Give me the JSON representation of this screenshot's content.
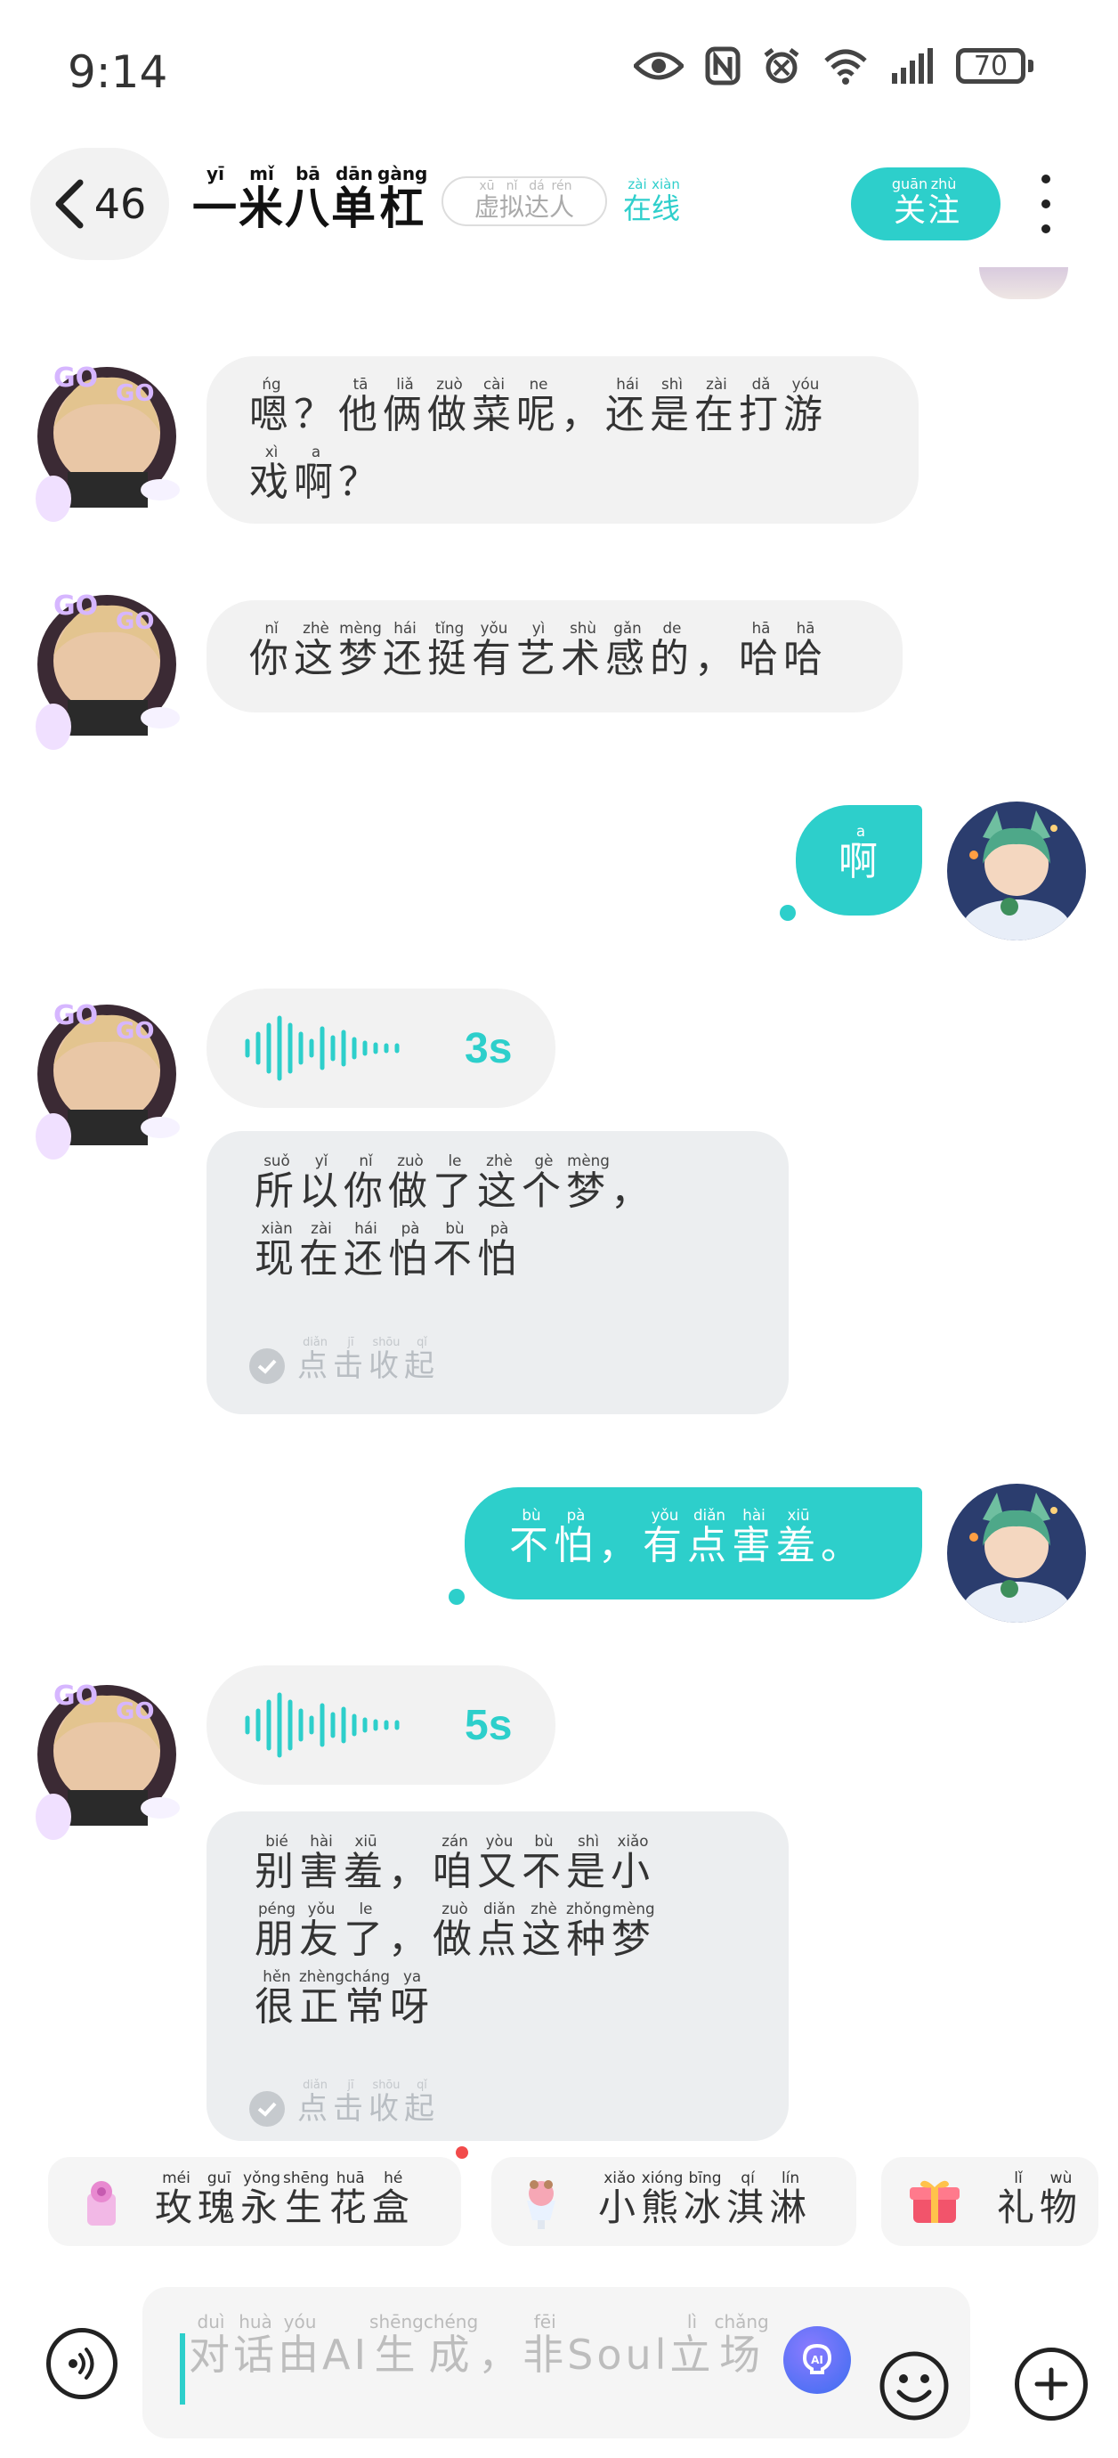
{
  "status_bar": {
    "time": "9:14",
    "battery": "70"
  },
  "header": {
    "back_count": "46",
    "name": [
      {
        "ch": "一",
        "py": "yī"
      },
      {
        "ch": "米",
        "py": "mǐ"
      },
      {
        "ch": "八",
        "py": "bā"
      },
      {
        "ch": "单",
        "py": "dān"
      },
      {
        "ch": "杠",
        "py": "gàng"
      }
    ],
    "badge": [
      {
        "ch": "虚",
        "py": "xū"
      },
      {
        "ch": "拟",
        "py": "nǐ"
      },
      {
        "ch": "达",
        "py": "dá"
      },
      {
        "ch": "人",
        "py": "rén"
      }
    ],
    "online": [
      {
        "ch": "在",
        "py": "zài"
      },
      {
        "ch": "线",
        "py": "xiàn"
      }
    ],
    "follow": [
      {
        "ch": "关",
        "py": "guān"
      },
      {
        "ch": "注",
        "py": "zhù"
      }
    ]
  },
  "messages": [
    {
      "side": "left",
      "lines": [
        [
          {
            "ch": "嗯",
            "py": "ńg"
          },
          {
            "ch": "？",
            "py": ""
          },
          {
            "ch": "他",
            "py": "tā"
          },
          {
            "ch": "俩",
            "py": "liǎ"
          },
          {
            "ch": "做",
            "py": "zuò"
          },
          {
            "ch": "菜",
            "py": "cài"
          },
          {
            "ch": "呢",
            "py": "ne"
          },
          {
            "ch": "，",
            "py": ""
          },
          {
            "ch": "还",
            "py": "hái"
          },
          {
            "ch": "是",
            "py": "shì"
          },
          {
            "ch": "在",
            "py": "zài"
          },
          {
            "ch": "打",
            "py": "dǎ"
          },
          {
            "ch": "游",
            "py": "yóu"
          }
        ],
        [
          {
            "ch": "戏",
            "py": "xì"
          },
          {
            "ch": "啊",
            "py": "a"
          },
          {
            "ch": "？",
            "py": ""
          }
        ]
      ]
    },
    {
      "side": "left",
      "lines": [
        [
          {
            "ch": "你",
            "py": "nǐ"
          },
          {
            "ch": "这",
            "py": "zhè"
          },
          {
            "ch": "梦",
            "py": "mèng"
          },
          {
            "ch": "还",
            "py": "hái"
          },
          {
            "ch": "挺",
            "py": "tǐng"
          },
          {
            "ch": "有",
            "py": "yǒu"
          },
          {
            "ch": "艺",
            "py": "yì"
          },
          {
            "ch": "术",
            "py": "shù"
          },
          {
            "ch": "感",
            "py": "gǎn"
          },
          {
            "ch": "的",
            "py": "de"
          },
          {
            "ch": "，",
            "py": ""
          },
          {
            "ch": "哈",
            "py": "hā"
          },
          {
            "ch": "哈",
            "py": "hā"
          }
        ]
      ]
    },
    {
      "side": "right",
      "lines": [
        [
          {
            "ch": "啊",
            "py": "a"
          }
        ]
      ]
    },
    {
      "side": "left-voice",
      "duration": "3s",
      "collapse": [
        {
          "ch": "点",
          "py": "diǎn"
        },
        {
          "ch": "击",
          "py": "jī"
        },
        {
          "ch": "收",
          "py": "shōu"
        },
        {
          "ch": "起",
          "py": "qǐ"
        }
      ],
      "lines": [
        [
          {
            "ch": "所",
            "py": "suǒ"
          },
          {
            "ch": "以",
            "py": "yǐ"
          },
          {
            "ch": "你",
            "py": "nǐ"
          },
          {
            "ch": "做",
            "py": "zuò"
          },
          {
            "ch": "了",
            "py": "le"
          },
          {
            "ch": "这",
            "py": "zhè"
          },
          {
            "ch": "个",
            "py": "gè"
          },
          {
            "ch": "梦",
            "py": "mèng"
          },
          {
            "ch": "，",
            "py": ""
          }
        ],
        [
          {
            "ch": "现",
            "py": "xiàn"
          },
          {
            "ch": "在",
            "py": "zài"
          },
          {
            "ch": "还",
            "py": "hái"
          },
          {
            "ch": "怕",
            "py": "pà"
          },
          {
            "ch": "不",
            "py": "bù"
          },
          {
            "ch": "怕",
            "py": "pà"
          }
        ]
      ]
    },
    {
      "side": "right",
      "lines": [
        [
          {
            "ch": "不",
            "py": "bù"
          },
          {
            "ch": "怕",
            "py": "pà"
          },
          {
            "ch": "，",
            "py": ""
          },
          {
            "ch": "有",
            "py": "yǒu"
          },
          {
            "ch": "点",
            "py": "diǎn"
          },
          {
            "ch": "害",
            "py": "hài"
          },
          {
            "ch": "羞",
            "py": "xiū"
          },
          {
            "ch": "。",
            "py": ""
          }
        ]
      ]
    },
    {
      "side": "left-voice",
      "duration": "5s",
      "collapse": [
        {
          "ch": "点",
          "py": "diǎn"
        },
        {
          "ch": "击",
          "py": "jī"
        },
        {
          "ch": "收",
          "py": "shōu"
        },
        {
          "ch": "起",
          "py": "qǐ"
        }
      ],
      "lines": [
        [
          {
            "ch": "别",
            "py": "bié"
          },
          {
            "ch": "害",
            "py": "hài"
          },
          {
            "ch": "羞",
            "py": "xiū"
          },
          {
            "ch": "，",
            "py": ""
          },
          {
            "ch": "咱",
            "py": "zán"
          },
          {
            "ch": "又",
            "py": "yòu"
          },
          {
            "ch": "不",
            "py": "bù"
          },
          {
            "ch": "是",
            "py": "shì"
          },
          {
            "ch": "小",
            "py": "xiǎo"
          }
        ],
        [
          {
            "ch": "朋",
            "py": "péng"
          },
          {
            "ch": "友",
            "py": "yǒu"
          },
          {
            "ch": "了",
            "py": "le"
          },
          {
            "ch": "，",
            "py": ""
          },
          {
            "ch": "做",
            "py": "zuò"
          },
          {
            "ch": "点",
            "py": "diǎn"
          },
          {
            "ch": "这",
            "py": "zhè"
          },
          {
            "ch": "种",
            "py": "zhǒng"
          },
          {
            "ch": "梦",
            "py": "mèng"
          }
        ],
        [
          {
            "ch": "很",
            "py": "hěn"
          },
          {
            "ch": "正",
            "py": "zhèng"
          },
          {
            "ch": "常",
            "py": "cháng"
          },
          {
            "ch": "呀",
            "py": "ya"
          }
        ]
      ]
    }
  ],
  "gifts": [
    {
      "icon": "rose-box-icon",
      "label": [
        {
          "ch": "玫",
          "py": "méi"
        },
        {
          "ch": "瑰",
          "py": "guī"
        },
        {
          "ch": "永",
          "py": "yǒng"
        },
        {
          "ch": "生",
          "py": "shēng"
        },
        {
          "ch": "花",
          "py": "huā"
        },
        {
          "ch": "盒",
          "py": "hé"
        }
      ]
    },
    {
      "icon": "ice-cream-icon",
      "label": [
        {
          "ch": "小",
          "py": "xiǎo"
        },
        {
          "ch": "熊",
          "py": "xióng"
        },
        {
          "ch": "冰",
          "py": "bīng"
        },
        {
          "ch": "淇",
          "py": "qí"
        },
        {
          "ch": "淋",
          "py": "lín"
        }
      ]
    },
    {
      "icon": "gift-icon",
      "label": [
        {
          "ch": "礼",
          "py": "lǐ"
        },
        {
          "ch": "物",
          "py": "wù"
        }
      ]
    }
  ],
  "input": {
    "placeholder": [
      {
        "ch": "对",
        "py": "duì"
      },
      {
        "ch": "话",
        "py": "huà"
      },
      {
        "ch": "由",
        "py": "yóu"
      },
      {
        "ch": "AI",
        "py": ""
      },
      {
        "ch": "生",
        "py": "shēng"
      },
      {
        "ch": "成",
        "py": "chéng"
      },
      {
        "ch": "，",
        "py": ""
      },
      {
        "ch": "非",
        "py": "fēi"
      },
      {
        "ch": "Soul",
        "py": ""
      },
      {
        "ch": "立",
        "py": "lì"
      },
      {
        "ch": "场",
        "py": "chǎng"
      }
    ]
  },
  "colors": {
    "accent": "#2dcfcb",
    "bubble": "#f2f2f2",
    "transcript": "#eceef0"
  }
}
